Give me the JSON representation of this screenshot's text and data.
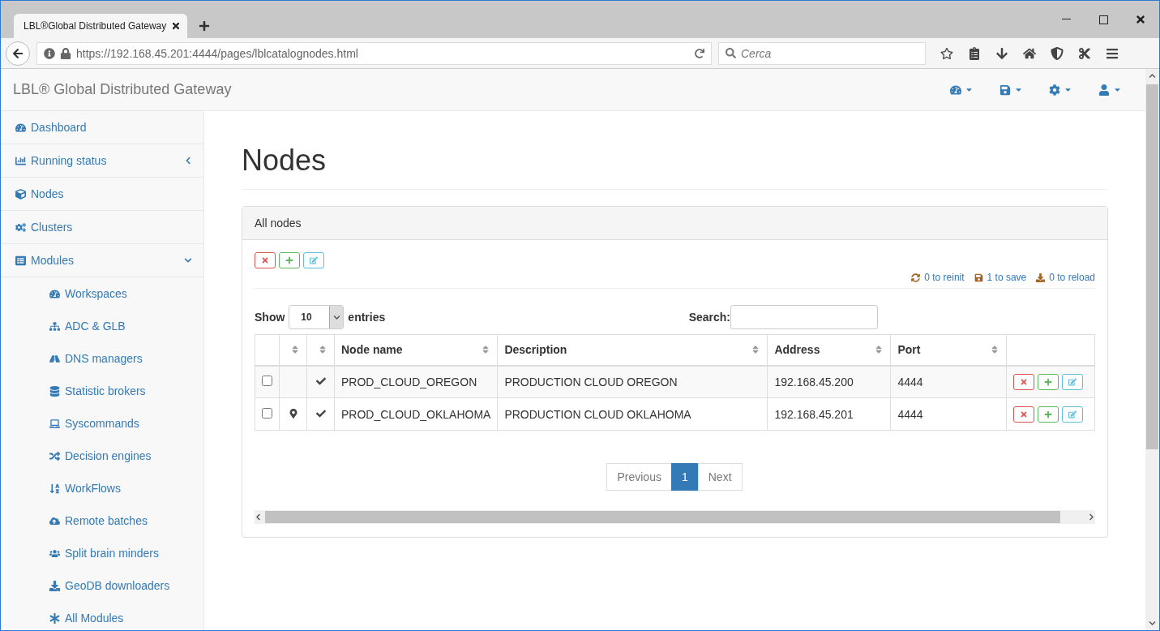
{
  "browser": {
    "tab_title": "LBL®Global Distributed Gateway",
    "url": "https://192.168.45.201:4444/pages/lblcatalognodes.html",
    "search_placeholder": "Cerca"
  },
  "navbar": {
    "brand": "LBL® Global Distributed Gateway"
  },
  "sidebar": {
    "items": [
      {
        "label": "Dashboard"
      },
      {
        "label": "Running status",
        "expanded": false
      },
      {
        "label": "Nodes"
      },
      {
        "label": "Clusters"
      },
      {
        "label": "Modules",
        "expanded": true,
        "children": [
          {
            "label": "Workspaces"
          },
          {
            "label": "ADC & GLB"
          },
          {
            "label": "DNS managers"
          },
          {
            "label": "Statistic brokers"
          },
          {
            "label": "Syscommands"
          },
          {
            "label": "Decision engines"
          },
          {
            "label": "WorkFlows"
          },
          {
            "label": "Remote batches"
          },
          {
            "label": "Split brain minders"
          },
          {
            "label": "GeoDB downloaders"
          },
          {
            "label": "All Modules"
          }
        ]
      }
    ]
  },
  "page": {
    "title": "Nodes"
  },
  "panel": {
    "heading": "All nodes",
    "counters": [
      {
        "text": "0 to reinit",
        "kind": "reinit"
      },
      {
        "text": "1 to save",
        "kind": "save"
      },
      {
        "text": "0 to reload",
        "kind": "reload"
      }
    ],
    "show_label": "Show",
    "entries_value": "10",
    "entries_label": "entries",
    "search_label": "Search:",
    "columns": [
      "Node name",
      "Description",
      "Address",
      "Port"
    ],
    "rows": [
      {
        "checked": false,
        "pinned": false,
        "verified": true,
        "cells": [
          "PROD_CLOUD_OREGON",
          "PRODUCTION CLOUD OREGON",
          "192.168.45.200",
          "4444"
        ]
      },
      {
        "checked": false,
        "pinned": true,
        "verified": true,
        "cells": [
          "PROD_CLOUD_OKLAHOMA",
          "PRODUCTION CLOUD OKLAHOMA",
          "192.168.45.201",
          "4444"
        ]
      }
    ],
    "pagination": {
      "previous": "Previous",
      "next": "Next",
      "pages": [
        {
          "label": "1",
          "selected": true
        }
      ]
    }
  }
}
